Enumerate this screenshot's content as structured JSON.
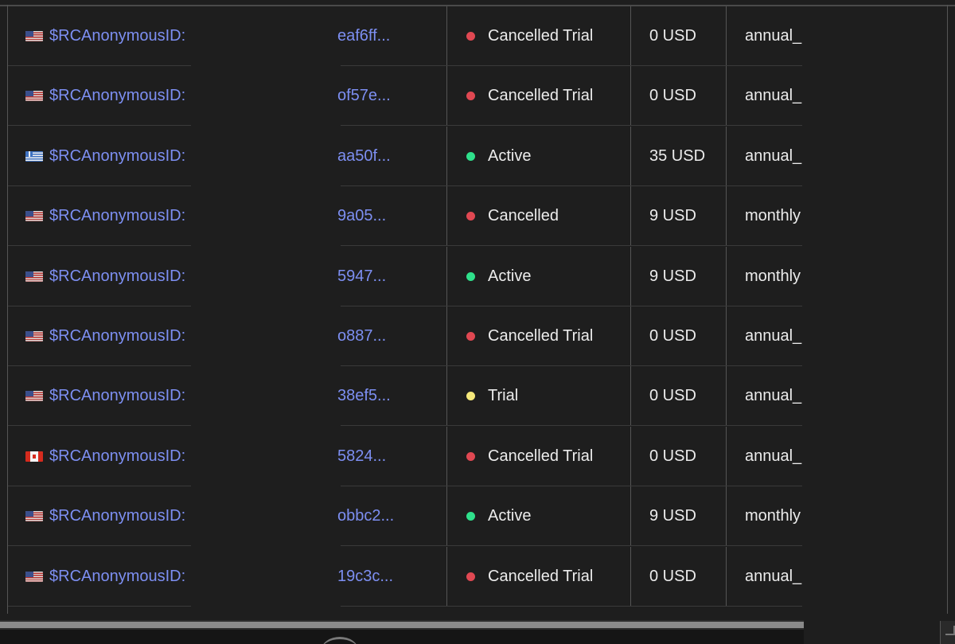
{
  "customers": {
    "rows": [
      {
        "flag": "us",
        "customer_id": "$RCAnonymousID:",
        "hash": "eaf6ff...",
        "status": "Cancelled Trial",
        "status_color": "#e04852",
        "price": "0 USD",
        "product": "annual_"
      },
      {
        "flag": "us",
        "customer_id": "$RCAnonymousID:",
        "hash": "of57e...",
        "status": "Cancelled Trial",
        "status_color": "#e04852",
        "price": "0 USD",
        "product": "annual_"
      },
      {
        "flag": "gr",
        "customer_id": "$RCAnonymousID:",
        "hash": "aa50f...",
        "status": "Active",
        "status_color": "#2fe08b",
        "price": "35 USD",
        "product": "annual_"
      },
      {
        "flag": "us",
        "customer_id": "$RCAnonymousID:",
        "hash": "9a05...",
        "status": "Cancelled",
        "status_color": "#e04852",
        "price": "9 USD",
        "product": "monthly"
      },
      {
        "flag": "us",
        "customer_id": "$RCAnonymousID:",
        "hash": "5947...",
        "status": "Active",
        "status_color": "#2fe08b",
        "price": "9 USD",
        "product": "monthly"
      },
      {
        "flag": "us",
        "customer_id": "$RCAnonymousID:",
        "hash": "o887...",
        "status": "Cancelled Trial",
        "status_color": "#e04852",
        "price": "0 USD",
        "product": "annual_"
      },
      {
        "flag": "us",
        "customer_id": "$RCAnonymousID:",
        "hash": "38ef5...",
        "status": "Trial",
        "status_color": "#f5e87a",
        "price": "0 USD",
        "product": "annual_"
      },
      {
        "flag": "ca",
        "customer_id": "$RCAnonymousID:",
        "hash": "5824...",
        "status": "Cancelled Trial",
        "status_color": "#e04852",
        "price": "0 USD",
        "product": "annual_"
      },
      {
        "flag": "us",
        "customer_id": "$RCAnonymousID:",
        "hash": "obbc2...",
        "status": "Active",
        "status_color": "#2fe08b",
        "price": "9 USD",
        "product": "monthly"
      },
      {
        "flag": "us",
        "customer_id": "$RCAnonymousID:",
        "hash": "19c3c...",
        "status": "Cancelled Trial",
        "status_color": "#e04852",
        "price": "0 USD",
        "product": "annual_"
      }
    ]
  },
  "colors": {
    "background": "#1e1e1e",
    "link": "#7d8ff2",
    "text": "#ececec",
    "status_active": "#2fe08b",
    "status_cancelled": "#e04852",
    "status_trial": "#f5e87a"
  }
}
